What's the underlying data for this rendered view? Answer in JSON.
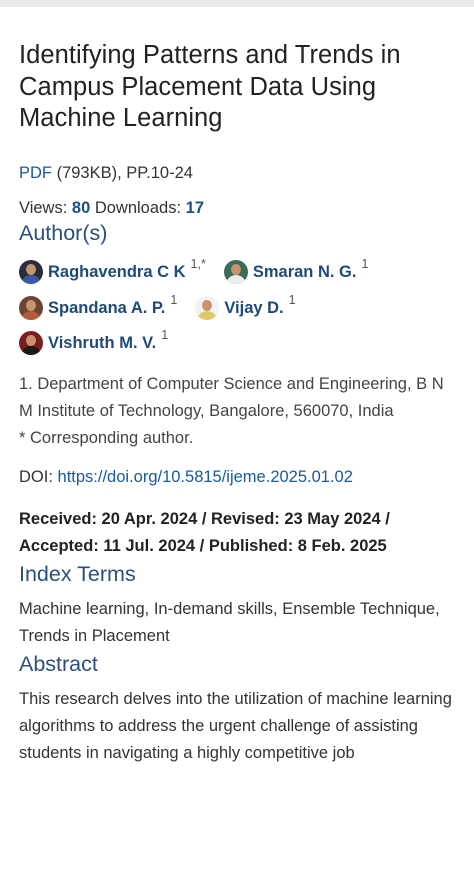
{
  "article": {
    "title": "Identifying Patterns and Trends in Campus Placement Data Using Machine Learning",
    "pdf_label": "PDF",
    "pdf_info": " (793KB), PP.10-24",
    "views_label": "Views: ",
    "views": "80",
    "downloads_label": " Downloads: ",
    "downloads": "17"
  },
  "authors": {
    "heading": "Author(s)",
    "list": [
      {
        "name": "Raghavendra C K",
        "sup": "1,*"
      },
      {
        "name": "Smaran N. G.",
        "sup": "1"
      },
      {
        "name": "Spandana A. P.",
        "sup": "1"
      },
      {
        "name": "Vijay D.",
        "sup": "1"
      },
      {
        "name": "Vishruth M. V.",
        "sup": "1"
      }
    ],
    "affiliation": "1. Department of Computer Science and Engineering, B N M Institute of Technology, Bangalore, 560070, India",
    "corresponding": "* Corresponding author."
  },
  "doi": {
    "label": "DOI: ",
    "url": "https://doi.org/10.5815/ijeme.2025.01.02"
  },
  "dates": {
    "line1": "Received: 20 Apr. 2024 / Revised: 23 May 2024 /",
    "line2": "Accepted: 11 Jul. 2024 / Published: 8 Feb. 2025"
  },
  "index_terms": {
    "heading": "Index Terms",
    "text": "Machine learning, In-demand skills, Ensemble Technique, Trends in Placement"
  },
  "abstract": {
    "heading": "Abstract",
    "text": "This research delves into the utilization of machine learning algorithms to address the urgent challenge of assisting students in navigating a highly competitive job"
  }
}
